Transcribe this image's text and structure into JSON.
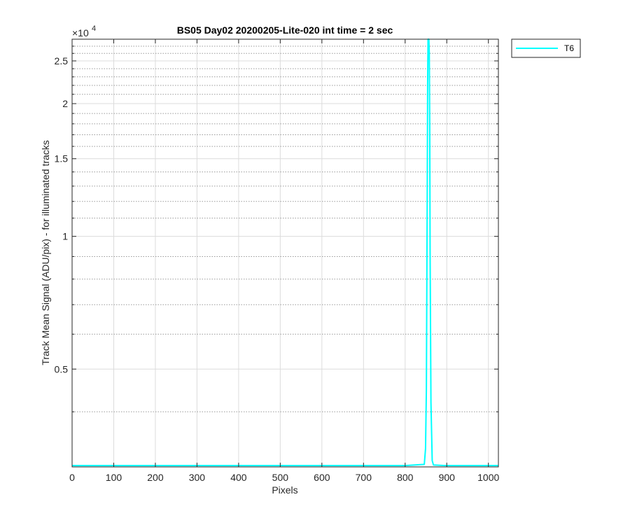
{
  "chart_data": {
    "type": "line",
    "title": "BS05 Day02 20200205-Lite-020 int time = 2 sec",
    "xlabel": "Pixels",
    "ylabel": "Track Mean Signal (ADU/pix) - for illuminated tracks",
    "exponent_label": "×10",
    "exponent_power": "4",
    "xlim": [
      0,
      1024
    ],
    "ylim": [
      3000,
      28000
    ],
    "yscale": "log",
    "grid": true,
    "legend_position": "outside-top-right",
    "x_ticks": [
      0,
      100,
      200,
      300,
      400,
      500,
      600,
      700,
      800,
      900,
      1000
    ],
    "x_tick_labels": [
      "0",
      "100",
      "200",
      "300",
      "400",
      "500",
      "600",
      "700",
      "800",
      "900",
      "1000"
    ],
    "y_ticks": [
      5000,
      10000,
      15000,
      20000,
      25000
    ],
    "y_tick_labels": [
      "0.5",
      "1",
      "1.5",
      "2",
      "2.5"
    ],
    "y_minor_ticks": [
      4000,
      6000,
      7000,
      8000,
      9000,
      11000,
      12000,
      13000,
      14000,
      16000,
      17000,
      18000,
      19000,
      21000,
      22000,
      23000,
      24000,
      26000,
      27000,
      28000
    ],
    "series": [
      {
        "name": "T6",
        "color": "#00ffff",
        "x": [
          0,
          200,
          400,
          600,
          800,
          846,
          849,
          851,
          853,
          854,
          855,
          856,
          857,
          858,
          859,
          860,
          862,
          865,
          868,
          900,
          1024
        ],
        "y": [
          3020,
          3020,
          3020,
          3020,
          3020,
          3040,
          3300,
          4500,
          12000,
          22000,
          28000,
          28000,
          28000,
          26000,
          18000,
          9000,
          4200,
          3100,
          3030,
          3020,
          3020
        ]
      }
    ]
  }
}
